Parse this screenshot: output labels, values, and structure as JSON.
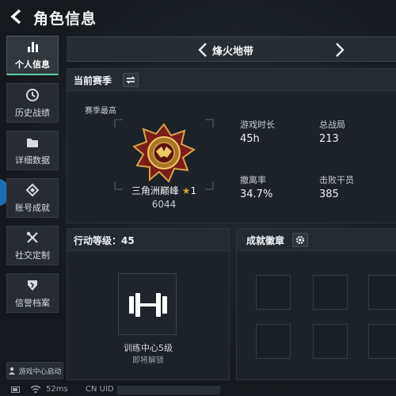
{
  "header": {
    "title": "角色信息"
  },
  "sidebar": {
    "items": [
      {
        "label": "个人信息",
        "icon": "bar-chart-icon",
        "active": true
      },
      {
        "label": "历史战绩",
        "icon": "clock-icon",
        "active": false
      },
      {
        "label": "详细数据",
        "icon": "folder-icon",
        "active": false
      },
      {
        "label": "账号成就",
        "icon": "diamond-badge-icon",
        "active": false
      },
      {
        "label": "社交定制",
        "icon": "tools-icon",
        "active": false
      },
      {
        "label": "信誉档案",
        "icon": "shield-icon",
        "active": false
      }
    ],
    "game_center": "游戏中心启动"
  },
  "season_switcher": {
    "name": "烽火地带"
  },
  "current_season": {
    "title": "当前赛季",
    "season_best_label": "赛季最高",
    "rank_name": "三角洲巅峰",
    "rank_star": "1",
    "rank_score": "6044",
    "stats": [
      {
        "label": "游戏时长",
        "value": "45h"
      },
      {
        "label": "总战局",
        "value": "213"
      },
      {
        "label": "撤离率",
        "value": "34.7%"
      },
      {
        "label": "击败干员",
        "value": "385"
      }
    ]
  },
  "action_level": {
    "title": "行动等级：45",
    "unlock_title": "训练中心5级",
    "unlock_sub": "即将解锁"
  },
  "achievements": {
    "title": "成就徽章"
  },
  "footer": {
    "ping": "52ms",
    "uid_label": "CN UID"
  },
  "colors": {
    "accent": "#5ed1a0",
    "gold": "#d9a441",
    "background": "#15191d"
  }
}
